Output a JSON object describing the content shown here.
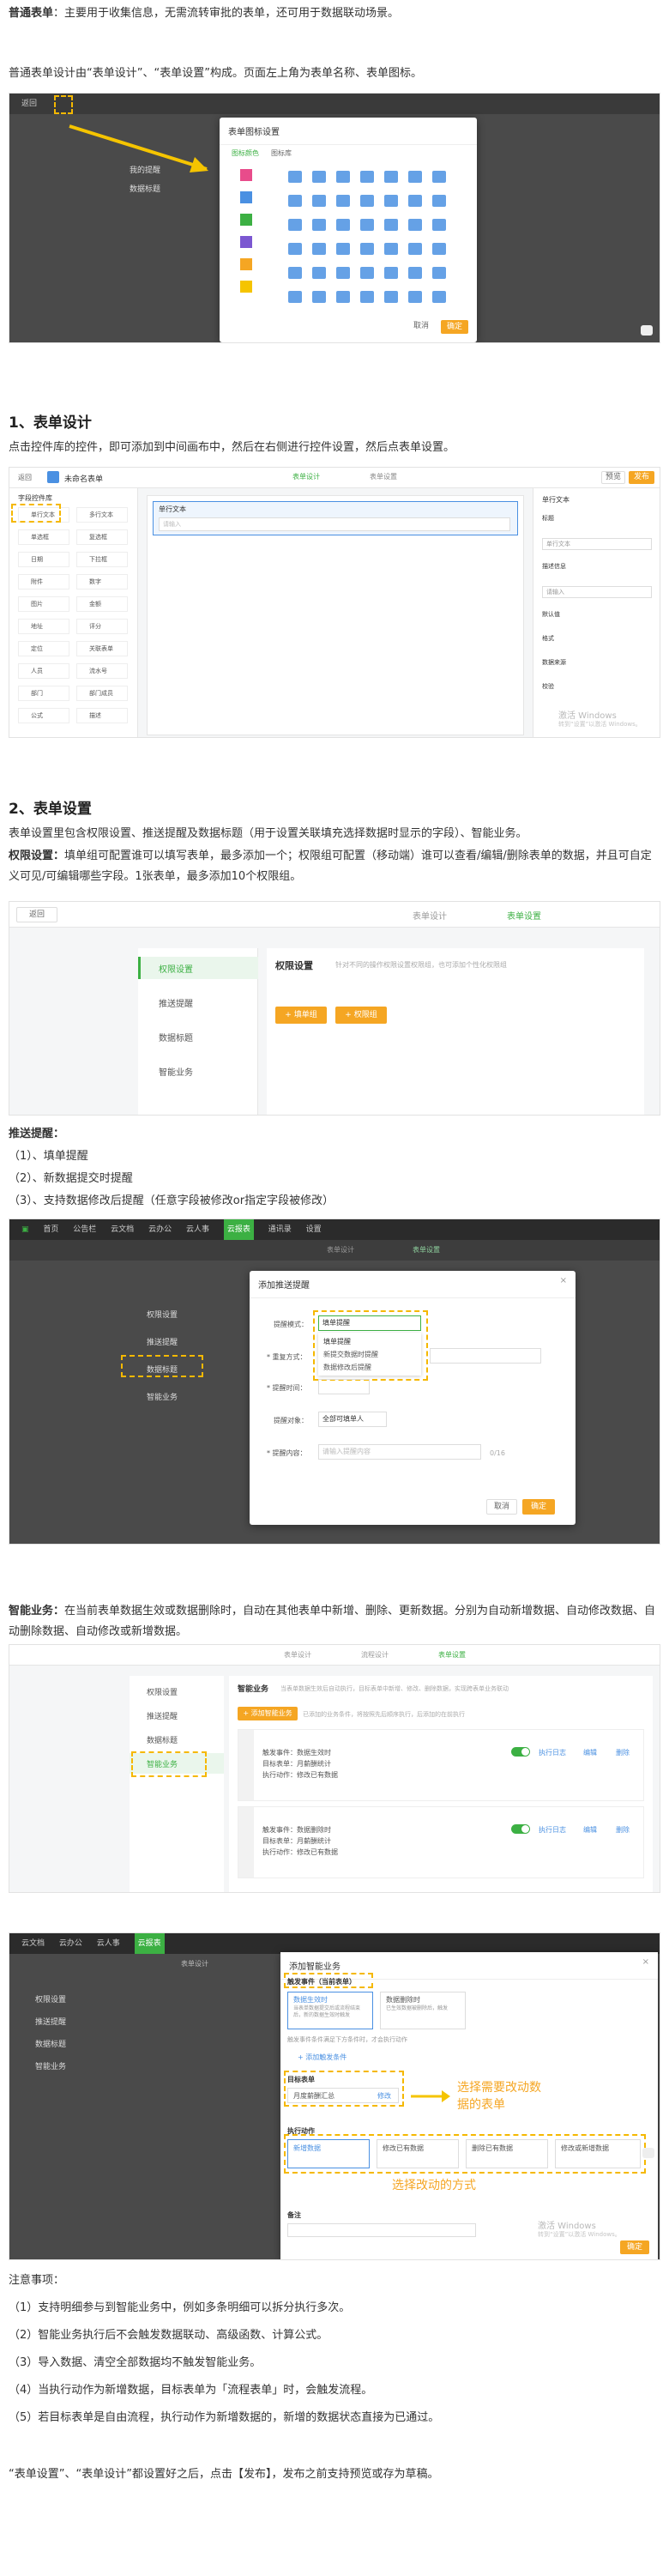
{
  "intro": {
    "bold": "普通表单",
    "text": "：主要用于收集信息，无需流转审批的表单，还可用于数据联动场景。",
    "line2": "普通表单设计由“表单设计”、“表单设置”构成。页面左上角为表单名称、表单图标。"
  },
  "shot1": {
    "back": "返回",
    "modal_title": "表单图标设置",
    "tab_icon": "图标颜色",
    "tab_bg": "图标库",
    "menu1": "我的提醒",
    "menu2": "数据标题",
    "cancel": "取消",
    "ok": "确定",
    "colors": [
      "#e84c8b",
      "#4a90e2",
      "#3cb043",
      "#7b57d1",
      "#f5a623",
      "#f5c400"
    ]
  },
  "section1": {
    "title": "1、表单设计",
    "desc": "点击控件库的控件，即可添加到中间画布中，然后在右侧进行控件设置，然后点表单设置。"
  },
  "shot2": {
    "back": "返回",
    "form_name": "未命名表单",
    "tab_design": "表单设计",
    "tab_setting": "表单设置",
    "preview": "预览",
    "publish": "发布",
    "lib_title": "字段控件库",
    "fields_left": [
      "单行文本",
      "单选框",
      "日期",
      "附件",
      "图片",
      "地址",
      "定位",
      "人员",
      "部门",
      "公式"
    ],
    "fields_right": [
      "多行文本",
      "复选框",
      "下拉框",
      "数字",
      "金额",
      "评分",
      "关联表单",
      "流水号",
      "部门成员",
      "描述"
    ],
    "canvas_label": "单行文本",
    "canvas_placeholder": "请输入",
    "right_title": "单行文本",
    "props": [
      "标题",
      "单行文本",
      "描述信息",
      "请输入",
      "默认值",
      "格式",
      "数据来源",
      "校验"
    ],
    "watermark1": "激活 Windows",
    "watermark2": "转到“设置”以激活 Windows。"
  },
  "section2": {
    "title": "2、表单设置",
    "desc": "表单设置里包含权限设置、推送提醒及数据标题（用于设置关联填充选择数据时显示的字段）、智能业务。",
    "perm_bold": "权限设置：",
    "perm_text": "填单组可配置谁可以填写表单，最多添加一个；权限组可配置（移动端）谁可以查看/编辑/删除表单的数据，并且可自定义可见/可编辑哪些字段。1张表单，最多添加10个权限组。"
  },
  "shot3": {
    "back": "返回",
    "step1": "表单设计",
    "step2": "表单设置",
    "menu": [
      "权限设置",
      "推送提醒",
      "数据标题",
      "智能业务"
    ],
    "section_title": "权限设置",
    "section_hint": "针对不同的操作权限设置权限组，也可添加个性化权限组",
    "btn1": "+ 填单组",
    "btn2": "+ 权限组"
  },
  "push": {
    "title": "推送提醒：",
    "items": [
      "（1）、填单提醒",
      "（2）、新数据提交时提醒",
      "（3）、支持数据修改后提醒（任意字段被修改or指定字段被修改）"
    ]
  },
  "shot4": {
    "top": [
      "首页",
      "公告栏",
      "云文档",
      "云办公",
      "云人事",
      "云报表",
      "通讯录",
      "设置"
    ],
    "step1": "表单设计",
    "step2": "表单设置",
    "menu": [
      "权限设置",
      "推送提醒",
      "数据标题",
      "智能业务"
    ],
    "modal_title": "添加推送提醒",
    "label1": "提醒模式：",
    "select1": "填单提醒",
    "opts": [
      "填单提醒",
      "新提交数据时提醒",
      "数据修改后提醒"
    ],
    "label2": "* 重复方式：",
    "label3": "* 提醒时间：",
    "label4": "提醒对象：",
    "obj": "全部可填单人",
    "label5": "* 提醒内容：",
    "content_ph": "请输入提醒内容",
    "counter": "0/16",
    "cancel": "取消",
    "ok": "确定"
  },
  "smart": {
    "bold": "智能业务：",
    "text": "在当前表单数据生效或数据删除时，自动在其他表单中新增、删除、更新数据。分别为自动新增数据、自动修改数据、自动删除数据、自动修改或新增数据。"
  },
  "shot5": {
    "step1": "表单设计",
    "step2": "流程设计",
    "step3": "表单设置",
    "menu": [
      "权限设置",
      "推送提醒",
      "数据标题",
      "智能业务"
    ],
    "title": "智能业务",
    "hint": "当表单数据生效后自动执行，目标表单中新增、修改、删除数据，实现跨表单业务联动",
    "add": "+ 添加智能业务",
    "add_hint": "已添加的业务条件，将按照先后顺序执行，后添加的在前执行",
    "rule_lines": [
      "触发事件：数据生效时",
      "目标表单：月薪酬统计",
      "执行动作：修改已有数据"
    ],
    "rule_lines2": [
      "触发事件：数据删除时",
      "目标表单：月薪酬统计",
      "执行动作：修改已有数据"
    ],
    "actions": [
      "执行日志",
      "编辑",
      "删除"
    ]
  },
  "shot6": {
    "top": [
      "云文档",
      "云办公",
      "云人事",
      "云报表"
    ],
    "design": "表单设计",
    "menu": [
      "权限设置",
      "推送提醒",
      "数据标题",
      "智能业务"
    ],
    "modal_title": "添加智能业务",
    "trigger": "触发事件（当前表单）",
    "trig1": "数据生效时",
    "trig1d": "当表单数据提交后或流程结束后，新的数据生效时触发",
    "trig2": "数据删除时",
    "trig2d": "已生效数据被删除后，触发",
    "trig_note": "触发事件条件满足下方条件时，才会执行动作",
    "add_filter": "+ 添加触发条件",
    "target": "目标表单",
    "target_val": "月度薪酬汇总",
    "target_btn": "修改",
    "callout1": "选择需要改动数据的表单",
    "action": "执行动作",
    "acts": [
      "新增数据",
      "修改已有数据",
      "删除已有数据",
      "修改或新增数据"
    ],
    "callout2": "选择改动的方式",
    "note": "备注",
    "watermark1": "激活 Windows",
    "watermark2": "转到“设置”以激活 Windows。",
    "ok": "确定"
  },
  "notes": {
    "title": "注意事项：",
    "items": [
      "（1）支持明细参与到智能业务中，例如多条明细可以拆分执行多次。",
      "（2）智能业务执行后不会触发数据联动、高级函数、计算公式。",
      "（3）导入数据、清空全部数据均不触发智能业务。",
      "（4）当执行动作为新增数据，目标表单为「流程表单」时，会触发流程。",
      "（5）若目标表单是自由流程，执行动作为新增数据的，新增的数据状态直接为已通过。"
    ],
    "footer": "“表单设置”、“表单设计”都设置好之后，点击【发布】，发布之前支持预览或存为草稿。"
  }
}
